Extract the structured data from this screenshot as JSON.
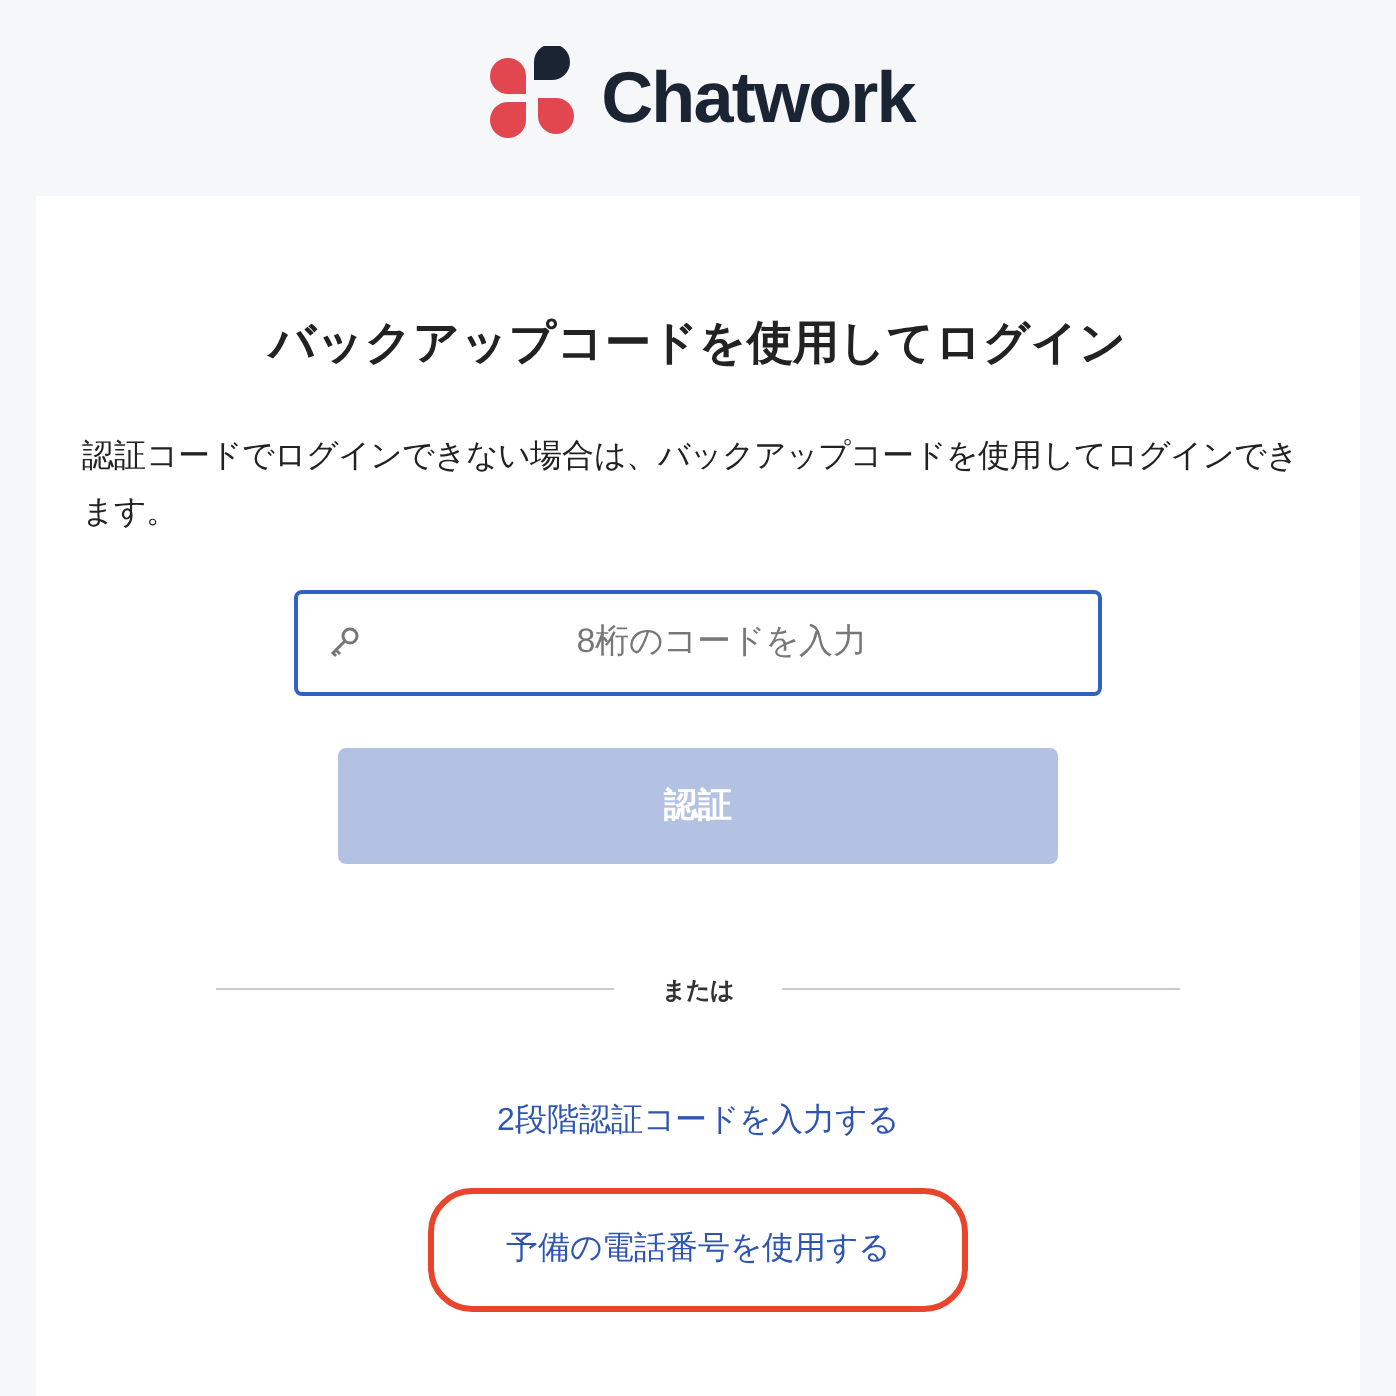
{
  "logo": {
    "text": "Chatwork"
  },
  "title": "バックアップコードを使用してログイン",
  "description": "認証コードでログインできない場合は、バックアップコードを使用してログインできます。",
  "code_field": {
    "placeholder": "8桁のコードを入力"
  },
  "submit_button": {
    "label": "認証",
    "disabled": true
  },
  "divider": "または",
  "links": [
    {
      "label": "2段階認証コードを入力する",
      "highlighted": false
    },
    {
      "label": "予備の電話番号を使用する",
      "highlighted": true
    }
  ]
}
